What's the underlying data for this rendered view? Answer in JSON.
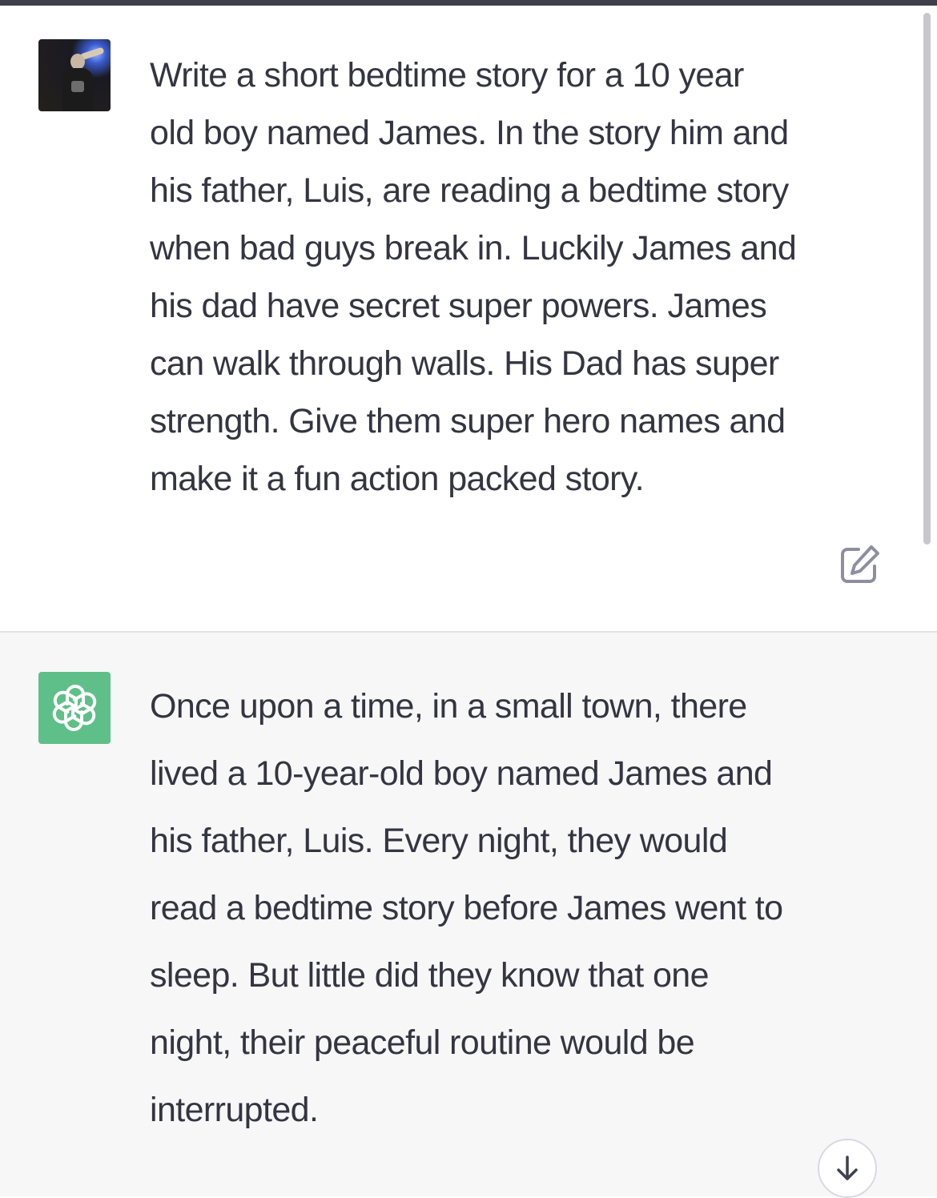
{
  "conversation": {
    "user_message": {
      "text": "Write a  short bedtime story for a 10 year\nold boy named James. In the story him and\nhis father, Luis, are reading a bedtime story\nwhen bad guys break in. Luckily James and\nhis dad have secret super powers. James\ncan walk through walls. His Dad has super\nstrength. Give them super hero names and\nmake it a fun action packed story.",
      "avatar_icon": "user-profile-photo",
      "edit_icon": "edit-icon"
    },
    "assistant_message": {
      "text": "Once upon a time, in a small town, there\nlived a 10-year-old boy named James and\nhis father, Luis. Every night, they would\nread a bedtime story before James went to\nsleep. But little did they know that one\nnight, their peaceful routine would be\ninterrupted.",
      "avatar_icon": "openai-logo-icon"
    }
  },
  "controls": {
    "scroll_down_icon": "arrow-down-icon"
  },
  "colors": {
    "assistant_avatar_bg": "#5fbf88",
    "assistant_block_bg": "#f7f7f8",
    "text": "#343541",
    "top_bar": "#3e3f4b"
  }
}
